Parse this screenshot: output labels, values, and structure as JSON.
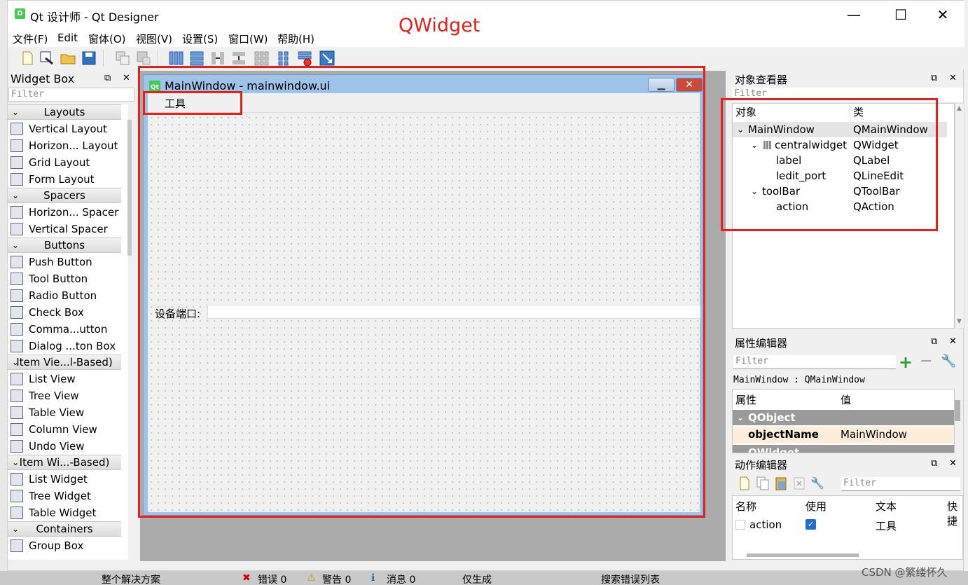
{
  "app": {
    "title": "Qt 设计师 - Qt Designer",
    "icon_letter": "D"
  },
  "window_buttons": {
    "minimize": "—",
    "maximize": "☐",
    "close": "✕"
  },
  "menu": [
    "文件(F)",
    "Edit",
    "窗体(O)",
    "视图(V)",
    "设置(S)",
    "窗口(W)",
    "帮助(H)"
  ],
  "overlay_label": "QWidget",
  "widget_box": {
    "title": "Widget Box",
    "filter_placeholder": "Filter",
    "categories": [
      {
        "label": "Layouts",
        "items": [
          "Vertical Layout",
          "Horizon... Layout",
          "Grid Layout",
          "Form Layout"
        ]
      },
      {
        "label": "Spacers",
        "items": [
          "Horizon... Spacer",
          "Vertical Spacer"
        ]
      },
      {
        "label": "Buttons",
        "items": [
          "Push Button",
          "Tool Button",
          "Radio Button",
          "Check Box",
          "Comma...utton",
          "Dialog ...ton Box"
        ]
      },
      {
        "label": "Item Vie...l-Based)",
        "items": [
          "List View",
          "Tree View",
          "Table View",
          "Column View",
          "Undo View"
        ]
      },
      {
        "label": "Item Wi...-Based)",
        "items": [
          "List Widget",
          "Tree Widget",
          "Table Widget"
        ]
      },
      {
        "label": "Containers",
        "items": [
          "Group Box"
        ]
      }
    ]
  },
  "form": {
    "title": "MainWindow - mainwindow.ui",
    "icon": "Qt",
    "menu_item": "工具",
    "port_label": "设备端口:",
    "port_value": ""
  },
  "object_inspector": {
    "title": "对象查看器",
    "filter_placeholder": "Filter",
    "col_object": "对象",
    "col_class": "类",
    "rows": [
      {
        "object": "MainWindow",
        "class": "QMainWindow",
        "depth": 0,
        "expanded": true
      },
      {
        "object": "centralwidget",
        "class": "QWidget",
        "depth": 1,
        "expanded": true
      },
      {
        "object": "label",
        "class": "QLabel",
        "depth": 2
      },
      {
        "object": "ledit_port",
        "class": "QLineEdit",
        "depth": 2
      },
      {
        "object": "toolBar",
        "class": "QToolBar",
        "depth": 1,
        "expanded": true
      },
      {
        "object": "action",
        "class": "QAction",
        "depth": 2
      }
    ]
  },
  "property_editor": {
    "title": "属性编辑器",
    "filter_placeholder": "Filter",
    "selection": "MainWindow : QMainWindow",
    "col_property": "属性",
    "col_value": "值",
    "group1": "QObject",
    "prop_name": "objectName",
    "prop_value": "MainWindow",
    "group2": "QWidget"
  },
  "action_editor": {
    "title": "动作编辑器",
    "filter_placeholder": "Filter",
    "cols": [
      "名称",
      "使用",
      "文本",
      "快捷"
    ],
    "rows": [
      {
        "name": "action",
        "used": true,
        "text": "工具"
      }
    ]
  },
  "bottom_strip": {
    "solution": "整个解决方案",
    "errors": "错误 0",
    "warnings": "警告 0",
    "messages": "消息 0",
    "build": "仅生成",
    "search": "搜索错误列表"
  },
  "watermark": "CSDN @繁缕怀久",
  "colors": {
    "highlight_red": "#e8201c",
    "group_gray": "#9a9a9a",
    "selected_prop": "#fdeedb"
  }
}
